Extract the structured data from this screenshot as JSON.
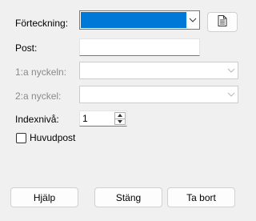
{
  "form": {
    "forteckning_label": "Förteckning:",
    "post_label": "Post:",
    "post_value": "",
    "nyckel1_label": "1:a nyckeln:",
    "nyckel2_label": "2:a nyckel:",
    "indexniva_label": "Indexnivå:",
    "indexniva_value": "1",
    "huvudpost_label": "Huvudpost",
    "huvudpost_checked": false
  },
  "buttons": {
    "help": "Hjälp",
    "close": "Stäng",
    "delete": "Ta bort"
  },
  "colors": {
    "selection": "#0078d7"
  },
  "icons": {
    "index_button": "document-icon",
    "dropdown": "chevron-down-icon",
    "spin_up": "spin-up-icon",
    "spin_down": "spin-down-icon"
  }
}
